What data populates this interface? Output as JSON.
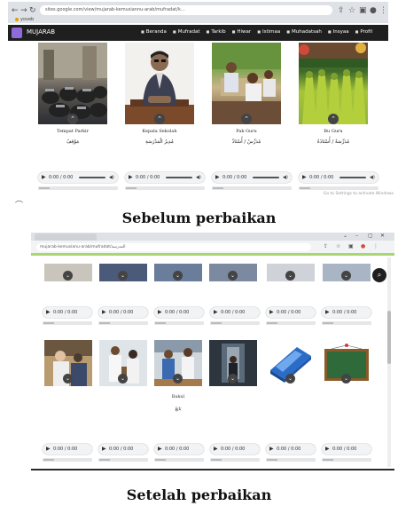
{
  "top_screenshot": {
    "url": "sites.google.com/view/mujarab-kemusiannu-arab/mufradat/k…",
    "bookmark": "yoveb",
    "site_name": "MUJARAB",
    "nav_items": [
      "Beranda",
      "Mufradat",
      "Tarkib",
      "Hiwar",
      "Istimaa",
      "Muhadatsah",
      "Insyaa",
      "Profil"
    ],
    "cards": [
      {
        "caption": "Tempat Parkir",
        "arabic": "مَوْقِفٌ"
      },
      {
        "caption": "Kepala Sekolah",
        "arabic": "مُدِيرُ الْمَدْرَسَةِ"
      },
      {
        "caption": "Pak Guru",
        "arabic": "مُدَرِّسٌ / أُسْتَاذٌ"
      },
      {
        "caption": "Bu Guru",
        "arabic": "مُدَرِّسَةٌ / أُسْتَاذَةٌ"
      }
    ],
    "audio_time": "0:00 / 0:00",
    "hint": "Go to Settings to activate Windows"
  },
  "label_before": "Sebelum perbaikan",
  "bottom_screenshot": {
    "url": "mujarab-kemusianu-arab/mufradat/المدرسة",
    "caption": "Bakul",
    "arabic": "بَائِعٌ",
    "audio_time": "0:00 / 0:00"
  },
  "label_after": "Setelah perbaikan",
  "colors": {
    "site_nav": "#1f1f1f",
    "logo": "#8e6bd8",
    "green_band": "#a8d66f",
    "audio_bg": "#f1f3f4"
  }
}
